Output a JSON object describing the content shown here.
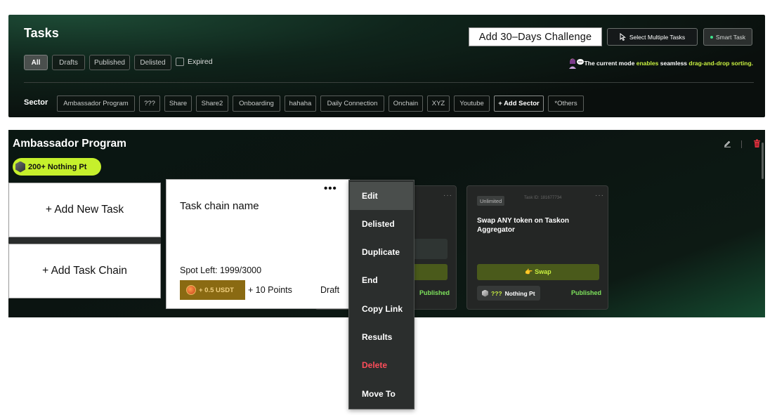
{
  "header": {
    "title": "Tasks",
    "challenge_button": "Add 30–Days Challenge",
    "select_multiple_label": "Select Multiple Tasks",
    "smart_task_label": "Smart Task",
    "mode_note": {
      "prefix": "The current mode ",
      "highlight1": "enables",
      "middle": " seamless ",
      "highlight2": "drag-and-drop sorting."
    }
  },
  "filters": [
    {
      "label": "All",
      "active": true
    },
    {
      "label": "Drafts",
      "active": false
    },
    {
      "label": "Published",
      "active": false
    },
    {
      "label": "Delisted",
      "active": false
    }
  ],
  "expired": {
    "label": "Expired",
    "checked": false
  },
  "sector": {
    "label": "Sector",
    "chips": [
      "Ambassador Program",
      "???",
      "Share",
      "Share2",
      "Onboarding",
      "hahaha",
      "Daily Connection",
      "Onchain",
      "XYZ",
      "Youtube",
      "+ Add Sector",
      "*Others"
    ]
  },
  "section": {
    "title": "Ambassador Program",
    "points_badge": "200+ Nothing Pt"
  },
  "actions": {
    "add_task": "+ Add New Task",
    "add_task_chain": "+ Add Task Chain"
  },
  "task_chain_card": {
    "name": "Task chain name",
    "menu_dots": "•••",
    "spot_left": "Spot Left: 1999/3000",
    "reward": "+ 0.5 USDT",
    "points": "+ 10 Points",
    "status": "Draft"
  },
  "partial_card": {
    "status": "Published"
  },
  "swap_card": {
    "tag": "Unlimited",
    "task_id": "Task ID: 181677734",
    "title": "Swap ANY token on Taskon Aggregator",
    "button": "👉 Swap",
    "reward_prefix": "???",
    "reward_suffix": " Nothing Pt",
    "status": "Published",
    "menu_dots": "···"
  },
  "context_menu": {
    "items": [
      {
        "label": "Edit",
        "active": true,
        "danger": false
      },
      {
        "label": "Delisted",
        "active": false,
        "danger": false
      },
      {
        "label": "Duplicate",
        "active": false,
        "danger": false
      },
      {
        "label": "End",
        "active": false,
        "danger": false
      },
      {
        "label": "Copy Link",
        "active": false,
        "danger": false
      },
      {
        "label": "Results",
        "active": false,
        "danger": false
      },
      {
        "label": "Delete",
        "active": false,
        "danger": true
      },
      {
        "label": "Move To",
        "active": false,
        "danger": false
      }
    ]
  },
  "colors": {
    "accent": "#c6f02c",
    "published": "#7ee35c",
    "danger": "#ff4d5a"
  }
}
